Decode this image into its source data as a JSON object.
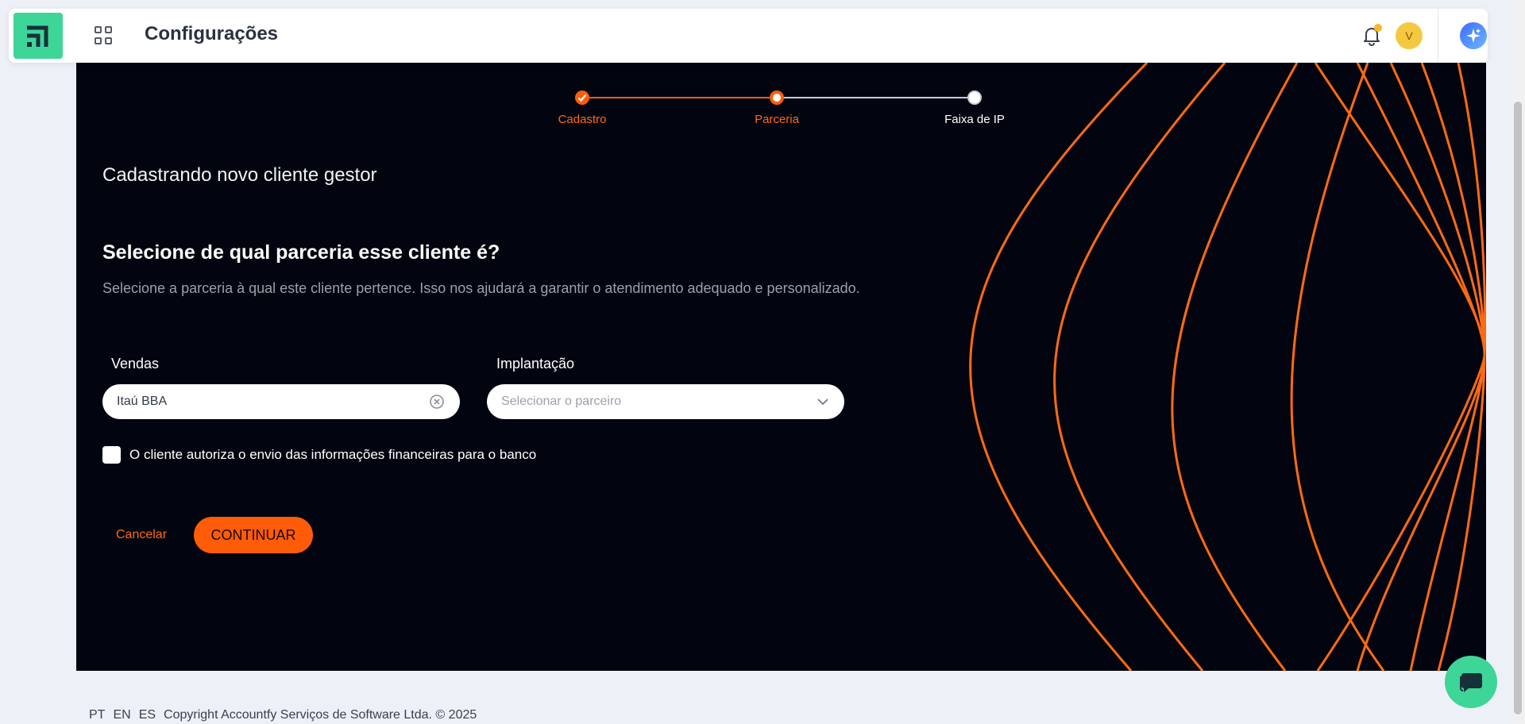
{
  "header": {
    "title": "Configurações",
    "avatar_initial": "V"
  },
  "stepper": {
    "steps": [
      {
        "label": "Cadastro",
        "state": "done"
      },
      {
        "label": "Parceria",
        "state": "current"
      },
      {
        "label": "Faixa de IP",
        "state": "pending"
      }
    ]
  },
  "form": {
    "heading": "Cadastrando novo cliente gestor",
    "question": "Selecione de qual parceria esse cliente é?",
    "description": "Selecione a parceria à qual este cliente pertence. Isso nos ajudará a garantir o atendimento adequado e personalizado.",
    "sales": {
      "label": "Vendas",
      "value": "Itaú BBA"
    },
    "implementation": {
      "label": "Implantação",
      "placeholder": "Selecionar o parceiro"
    },
    "consent_label": "O cliente autoriza o envio das informações financeiras para o banco",
    "consent_checked": false,
    "cancel_label": "Cancelar",
    "continue_label": "CONTINUAR"
  },
  "footer": {
    "languages": [
      "PT",
      "EN",
      "ES"
    ],
    "copyright": "Copyright Accountfy Serviços de Software Ltda. © 2025"
  },
  "colors": {
    "accent": "#ff5c0a",
    "brand_green": "#3dd598",
    "panel_bg": "#02050f"
  },
  "icons": {
    "logo": "accountfy-logo-icon",
    "apps": "apps-grid-icon",
    "bell": "bell-icon",
    "ai": "sparkle-icon",
    "clear": "clear-circle-icon",
    "chevron": "chevron-down-icon",
    "chat": "chat-bubble-icon",
    "check": "check-icon"
  }
}
